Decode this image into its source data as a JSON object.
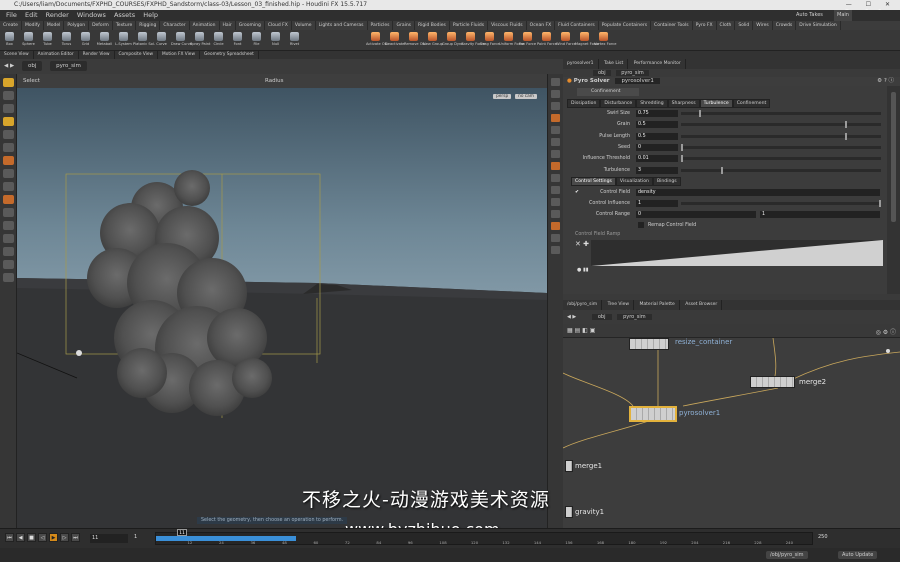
{
  "window": {
    "title": "C:/Users/liam/Documents/FXPHD_COURSES/FXPHD_Sandstorm/class-03/Lesson_03_finished.hip - Houdini FX 15.5.717",
    "watermark_brand": "fxphd"
  },
  "menu": [
    "File",
    "Edit",
    "Render",
    "Windows",
    "Assets",
    "Help"
  ],
  "shelf": {
    "tabs": [
      "Create",
      "Modify",
      "Model",
      "Polygon",
      "Deform",
      "Texture",
      "Rigging",
      "Character",
      "Animation",
      "Hair",
      "Grooming",
      "Cloud FX",
      "Volume",
      "Lights and Cameras",
      "Particles",
      "Grains",
      "Rigid Bodies",
      "Particle Fluids",
      "Viscous Fluids",
      "Ocean FX",
      "Fluid Containers",
      "Populate Containers",
      "Container Tools",
      "Pyro FX",
      "Cloth",
      "Solid",
      "Wires",
      "Crowds",
      "Drive Simulation"
    ],
    "tools_left": [
      "Box",
      "Sphere",
      "Tube",
      "Torus",
      "Grid",
      "Metaball",
      "L-System",
      "Platonic Sol.",
      "Curve",
      "Draw Curve",
      "Spray Paint",
      "Circle",
      "Font",
      "File",
      "Null",
      "Rivet"
    ],
    "tools_right": [
      "Activate Ob.",
      "Deactivate",
      "Remove Ob.",
      "New Group",
      "Group Dyna.",
      "Gravity Force",
      "Drag Force",
      "Uniform Force",
      "Fan Force",
      "Point Force",
      "Wind Force",
      "Magnet Force",
      "Vortex Force"
    ]
  },
  "pane_tabs": [
    "Scene View",
    "Animation Editor",
    "Render View",
    "Composite View",
    "Motion FX View",
    "Geometry Spreadsheet"
  ],
  "viewport": {
    "path_obj": "obj",
    "path_node": "pyro_sim",
    "tool": "Select",
    "radius_label": "Radius",
    "badge_persp": "persp",
    "badge_cam": "no cam"
  },
  "params": {
    "tabs": [
      "pyrosolver1",
      "Take List",
      "Performance Monitor"
    ],
    "path_obj": "obj",
    "path_node": "pyro_sim",
    "node_type": "Pyro Solver",
    "node_name": "pyrosolver1",
    "section": "Confinement",
    "subtabs": [
      "Dissipation",
      "Disturbance",
      "Shredding",
      "Sharpness",
      "Turbulence",
      "Confinement"
    ],
    "rows": [
      {
        "label": "Swirl Size",
        "value": "0.75",
        "fill": 0.09
      },
      {
        "label": "Grain",
        "value": "0.5",
        "fill": 0.83
      },
      {
        "label": "Pulse Length",
        "value": "0.5",
        "fill": 0.83
      },
      {
        "label": "Seed",
        "value": "0",
        "fill": 0.0
      },
      {
        "label": "Influence Threshold",
        "value": "0.01",
        "fill": 0.0
      },
      {
        "label": "Turbulence",
        "value": "3",
        "fill": 0.2
      }
    ],
    "ctl_tabs": [
      "Control Settings",
      "Visualization",
      "Bindings"
    ],
    "control_field_label": "Control Field",
    "control_field_value": "density",
    "control_influence_label": "Control Influence",
    "control_influence_value": "1",
    "control_range_label": "Control Range",
    "control_range_min": "0",
    "control_range_max": "1",
    "remap_label": "Remap Control Field",
    "ramp_label": "Control Field Ramp"
  },
  "network": {
    "tabs": [
      "/obj/pyro_sim",
      "Tree View",
      "Material Palette",
      "Asset Browser"
    ],
    "path_obj": "obj",
    "path_node": "pyro_sim",
    "nodes": [
      "resize_container",
      "pyrosolver1",
      "merge2",
      "merge1",
      "gravity1"
    ]
  },
  "timeline": {
    "frame": "11",
    "start": "1",
    "end": "250",
    "cursor": "11",
    "ticks": [
      "12",
      "24",
      "36",
      "48",
      "60",
      "72",
      "84",
      "96",
      "108",
      "120",
      "132",
      "144",
      "156",
      "168",
      "180",
      "192",
      "204",
      "216",
      "228",
      "240"
    ]
  },
  "status": {
    "hint": "Select the geometry, then choose an operation to perform.",
    "path": "/obj/pyro_sim",
    "update": "Auto Update",
    "right_top": "Auto Takes",
    "main": "Main"
  },
  "overlay": {
    "subtitle": "不移之火-动漫游戏美术资源",
    "url": "www.byzhihuo.com"
  }
}
